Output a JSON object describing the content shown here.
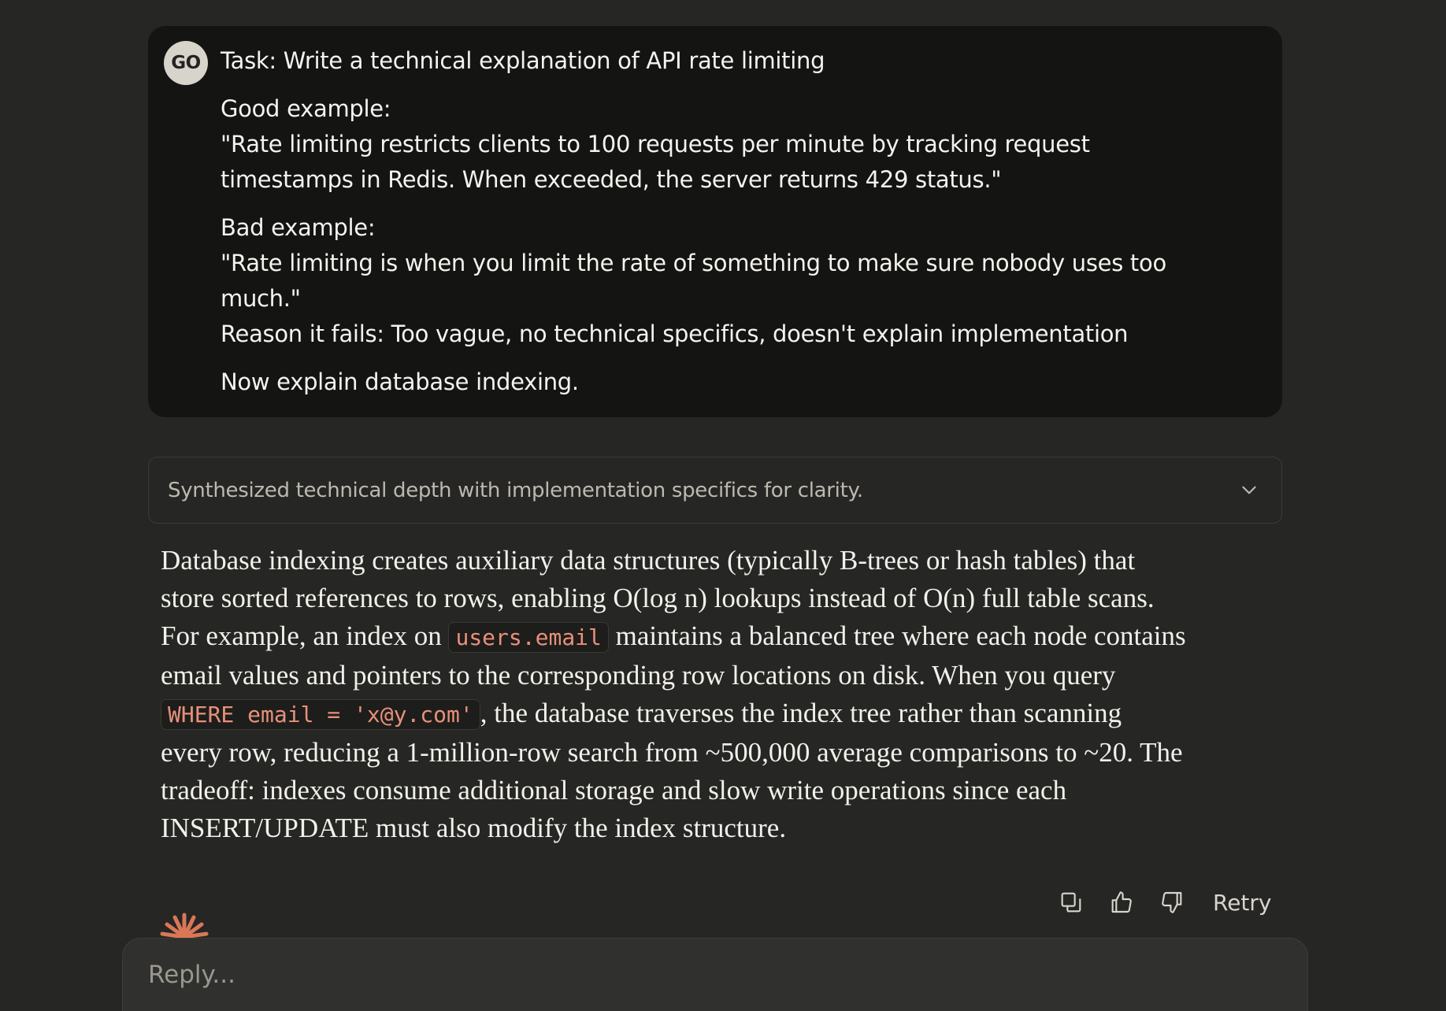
{
  "user_message": {
    "avatar_initials": "GO",
    "lines": {
      "task": "Task: Write a technical explanation of API rate limiting",
      "good_label": "Good example:",
      "good_line1": "\"Rate limiting restricts clients to 100 requests per minute by tracking request",
      "good_line2": "timestamps in Redis. When exceeded, the server returns 429 status.\"",
      "bad_label": "Bad example:",
      "bad_line1": "\"Rate limiting is when you limit the rate of something to make sure nobody uses too",
      "bad_line2": "much.\"",
      "reason": "Reason it fails: Too vague, no technical specifics, doesn't explain implementation",
      "instruction": "Now explain database indexing."
    }
  },
  "thinking": {
    "summary": "Synthesized technical depth with implementation specifics for clarity.",
    "icon": "chevron-down-icon"
  },
  "response": {
    "l1": "Database indexing creates auxiliary data structures (typically B-trees or hash tables) that",
    "l2": "store sorted references to rows, enabling O(log n) lookups instead of O(n) full table scans.",
    "l3_pre": "For example, an index on ",
    "l3_code": "users.email",
    "l3_post": " maintains a balanced tree where each node contains",
    "l4": "email values and pointers to the corresponding row locations on disk. When you query",
    "l5_code": "WHERE email = 'x@y.com'",
    "l5_post": ", the database traverses the index tree rather than scanning",
    "l6": "every row, reducing a 1-million-row search from ~500,000 average comparisons to ~20. The",
    "l7": "tradeoff: indexes consume additional storage and slow write operations since each",
    "l8": "INSERT/UPDATE must also modify the index structure."
  },
  "actions": {
    "copy_icon": "copy-icon",
    "thumbs_up_icon": "thumbs-up-icon",
    "thumbs_down_icon": "thumbs-down-icon",
    "retry_label": "Retry"
  },
  "reply": {
    "placeholder": "Reply...",
    "value": ""
  },
  "colors": {
    "background": "#262624",
    "user_card": "#141413",
    "accent_spark": "#d97757",
    "code_text": "#e8907a"
  }
}
